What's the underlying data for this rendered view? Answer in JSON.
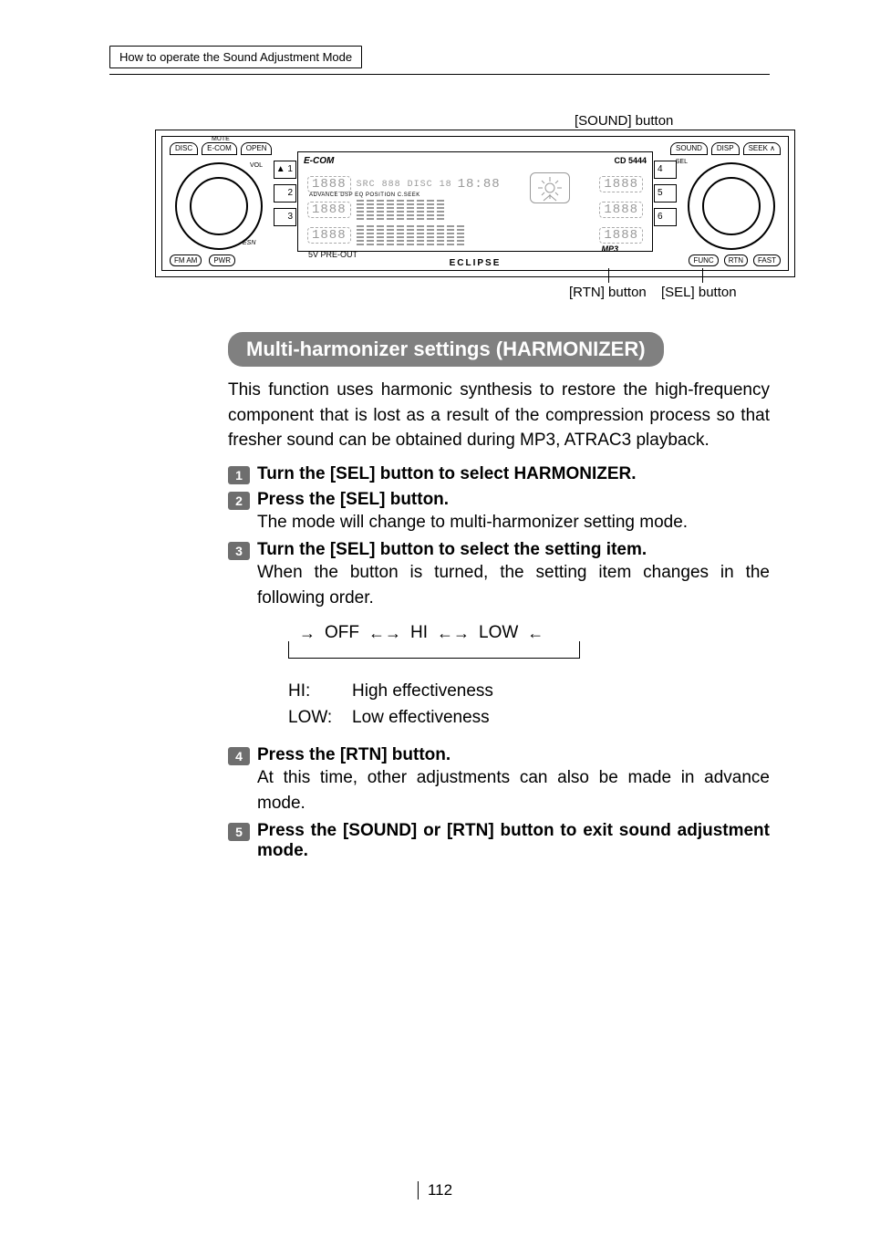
{
  "header": {
    "breadcrumb": "How to operate the Sound Adjustment Mode"
  },
  "callouts": {
    "sound": "[SOUND] button",
    "rtn": "[RTN] button",
    "sel": "[SEL] button"
  },
  "panel": {
    "top_left": [
      "DISC",
      "E-COM",
      "OPEN"
    ],
    "top_right": [
      "SOUND",
      "DISP",
      "SEEK ∧"
    ],
    "bot_left": [
      "FM AM",
      "PWR"
    ],
    "bot_right": [
      "FUNC",
      "RTN",
      "FAST"
    ],
    "mute": "MUTE",
    "vol": "VOL",
    "esn": "ESN",
    "sel": "SEL",
    "presets_l": [
      "▲  1",
      "2",
      "3"
    ],
    "presets_r": [
      "4",
      "5",
      "6"
    ],
    "screen_title": "E-COM",
    "screen_cd": "CD 5444",
    "preout": "5V PRE-OUT",
    "mp3": "MP3",
    "brand": "ECLIPSE",
    "lcd_time": "18:88",
    "lcd_small_labels": "ADVANCE  DSP  EQ  POSITION  C.SEEK",
    "lcd_src_disc": "SRC 888 DISC 18",
    "lcd_888": "1888"
  },
  "section": {
    "title": "Multi-harmonizer settings (HARMONIZER)"
  },
  "intro": "This function uses harmonic synthesis to restore the high-frequency component that is lost as a result of the compression process so that fresher sound can be obtained during MP3, ATRAC3 playback.",
  "steps": {
    "s1": {
      "n": "1",
      "head": "Turn the [SEL] button to select HARMONIZER."
    },
    "s2": {
      "n": "2",
      "head": "Press the [SEL] button.",
      "sub": "The mode will change to multi-harmonizer setting mode."
    },
    "s3": {
      "n": "3",
      "head": "Turn the [SEL] button to select the setting item.",
      "sub": "When the button is turned, the setting item changes in the following order."
    },
    "s4": {
      "n": "4",
      "head": "Press the [RTN] button.",
      "sub": "At this time, other adjustments can also be made in advance mode."
    },
    "s5": {
      "n": "5",
      "head": "Press the [SOUND] or [RTN] button to exit sound adjustment mode."
    }
  },
  "cycle": {
    "a": "OFF",
    "b": "HI",
    "c": "LOW"
  },
  "defs": {
    "hi_k": "HI:",
    "hi_v": "High effectiveness",
    "low_k": "LOW:",
    "low_v": "Low effectiveness"
  },
  "page_number": "112"
}
